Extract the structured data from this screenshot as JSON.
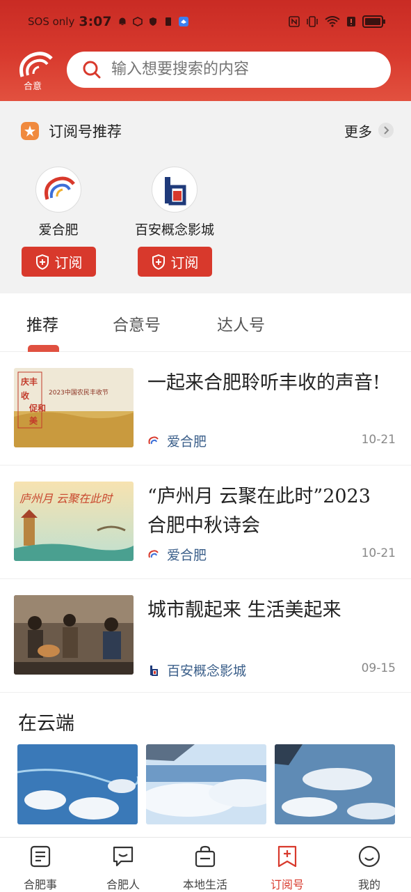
{
  "status_bar": {
    "carrier": "SOS only",
    "time": "3:07"
  },
  "header": {
    "logo_text": "合意"
  },
  "search": {
    "placeholder": "输入想要搜索的内容"
  },
  "recommend": {
    "title": "订阅号推荐",
    "more_label": "更多",
    "accounts": [
      {
        "name": "爱合肥",
        "subscribe_label": "订阅"
      },
      {
        "name": "百安概念影城",
        "subscribe_label": "订阅"
      }
    ]
  },
  "tabs": [
    {
      "label": "推荐",
      "active": true
    },
    {
      "label": "合意号",
      "active": false
    },
    {
      "label": "达人号",
      "active": false
    }
  ],
  "articles": [
    {
      "title": "一起来合肥聆听丰收的声音!",
      "source": "爱合肥",
      "date": "10-21",
      "thumb_text": {
        "left": "庆丰收 促和美",
        "line1": "2023中国农民丰收节"
      }
    },
    {
      "title": "“庐州月 云聚在此时”2023合肥中秋诗会",
      "source": "爱合肥",
      "date": "10-21",
      "thumb_text": {
        "line1": "庐州月 云聚在此时"
      }
    },
    {
      "title": "城市靓起来 生活美起来",
      "source": "百安概念影城",
      "date": "09-15"
    }
  ],
  "section": {
    "title": "在云端"
  },
  "bottom_nav": [
    {
      "label": "合肥事",
      "icon": "news-icon",
      "active": false
    },
    {
      "label": "合肥人",
      "icon": "chat-icon",
      "active": false
    },
    {
      "label": "本地生活",
      "icon": "bag-icon",
      "active": false
    },
    {
      "label": "订阅号",
      "icon": "subscribe-icon",
      "active": true
    },
    {
      "label": "我的",
      "icon": "smile-icon",
      "active": false
    }
  ],
  "colors": {
    "brand": "#d8392c",
    "header": "#c92b24",
    "link": "#3b5f8a"
  }
}
